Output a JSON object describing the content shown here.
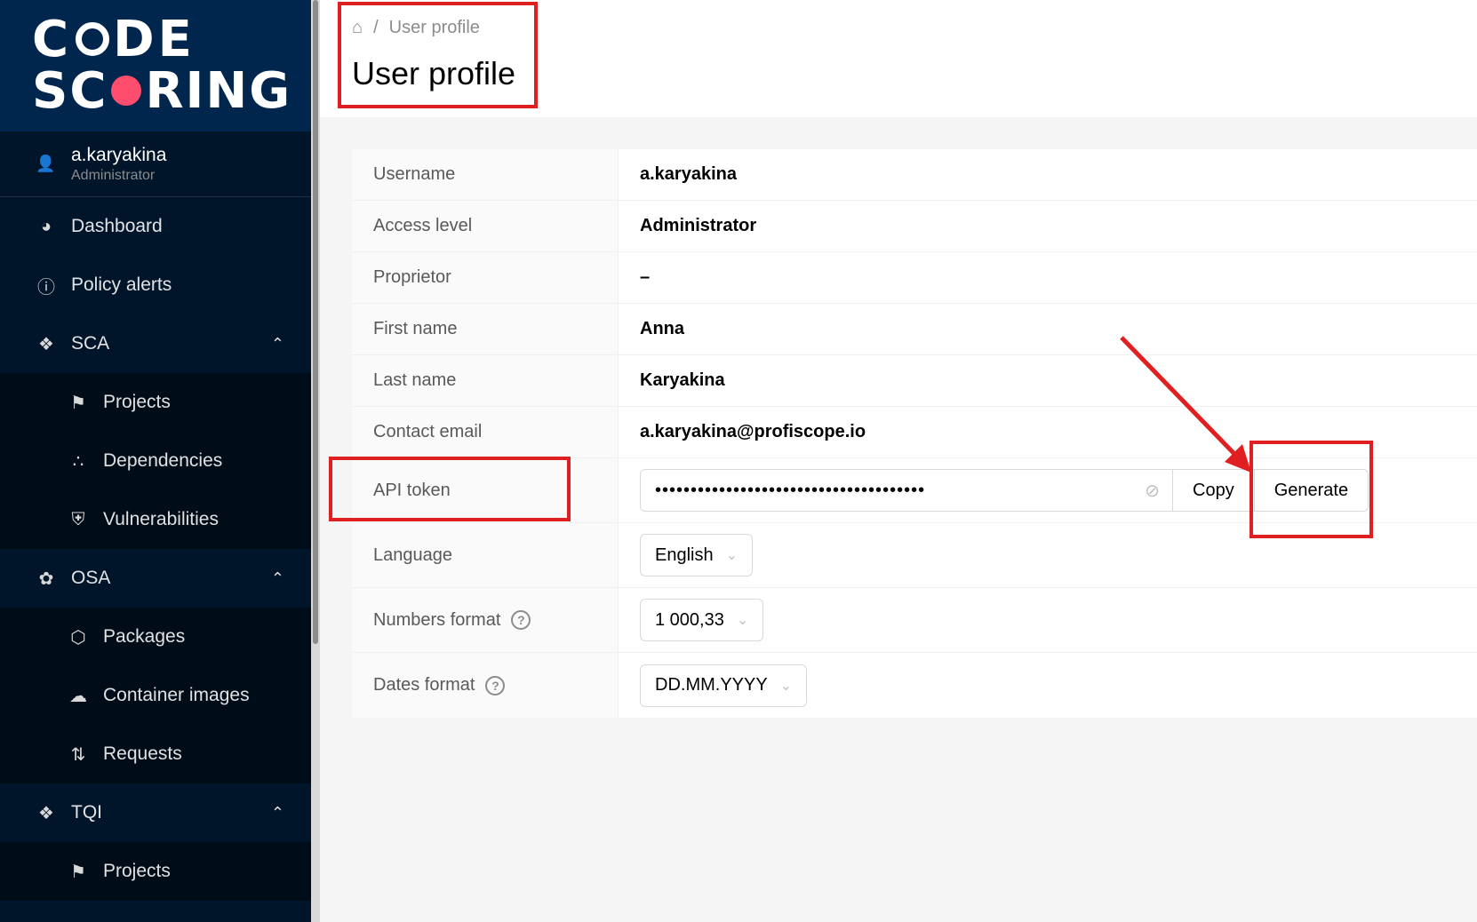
{
  "logo": {
    "line1": "C  DE",
    "line2_a": "SC",
    "line2_b": "RING"
  },
  "user": {
    "name": "a.karyakina",
    "role": "Administrator"
  },
  "sidebar": {
    "items": [
      {
        "label": "Dashboard"
      },
      {
        "label": "Policy alerts"
      },
      {
        "label": "SCA"
      },
      {
        "label": "Projects"
      },
      {
        "label": "Dependencies"
      },
      {
        "label": "Vulnerabilities"
      },
      {
        "label": "OSA"
      },
      {
        "label": "Packages"
      },
      {
        "label": "Container images"
      },
      {
        "label": "Requests"
      },
      {
        "label": "TQI"
      },
      {
        "label": "Projects"
      }
    ]
  },
  "breadcrumb": {
    "current": "User profile",
    "separator": "/"
  },
  "page": {
    "title": "User profile"
  },
  "profile": {
    "rows": [
      {
        "label": "Username",
        "value": "a.karyakina"
      },
      {
        "label": "Access level",
        "value": "Administrator"
      },
      {
        "label": "Proprietor",
        "value": "–"
      },
      {
        "label": "First name",
        "value": "Anna"
      },
      {
        "label": "Last name",
        "value": "Karyakina"
      },
      {
        "label": "Contact email",
        "value": "a.karyakina@profiscope.io"
      }
    ],
    "api_token": {
      "label": "API token",
      "masked": "••••••••••••••••••••••••••••••••••••••",
      "copy_label": "Copy",
      "generate_label": "Generate"
    },
    "language": {
      "label": "Language",
      "value": "English"
    },
    "numbers_format": {
      "label": "Numbers format",
      "value": "1 000,33"
    },
    "dates_format": {
      "label": "Dates format",
      "value": "DD.MM.YYYY"
    }
  },
  "colors": {
    "sidebar_bg": "#001529",
    "annotation": "#e02020",
    "logo_accent": "#ff4d6d"
  }
}
